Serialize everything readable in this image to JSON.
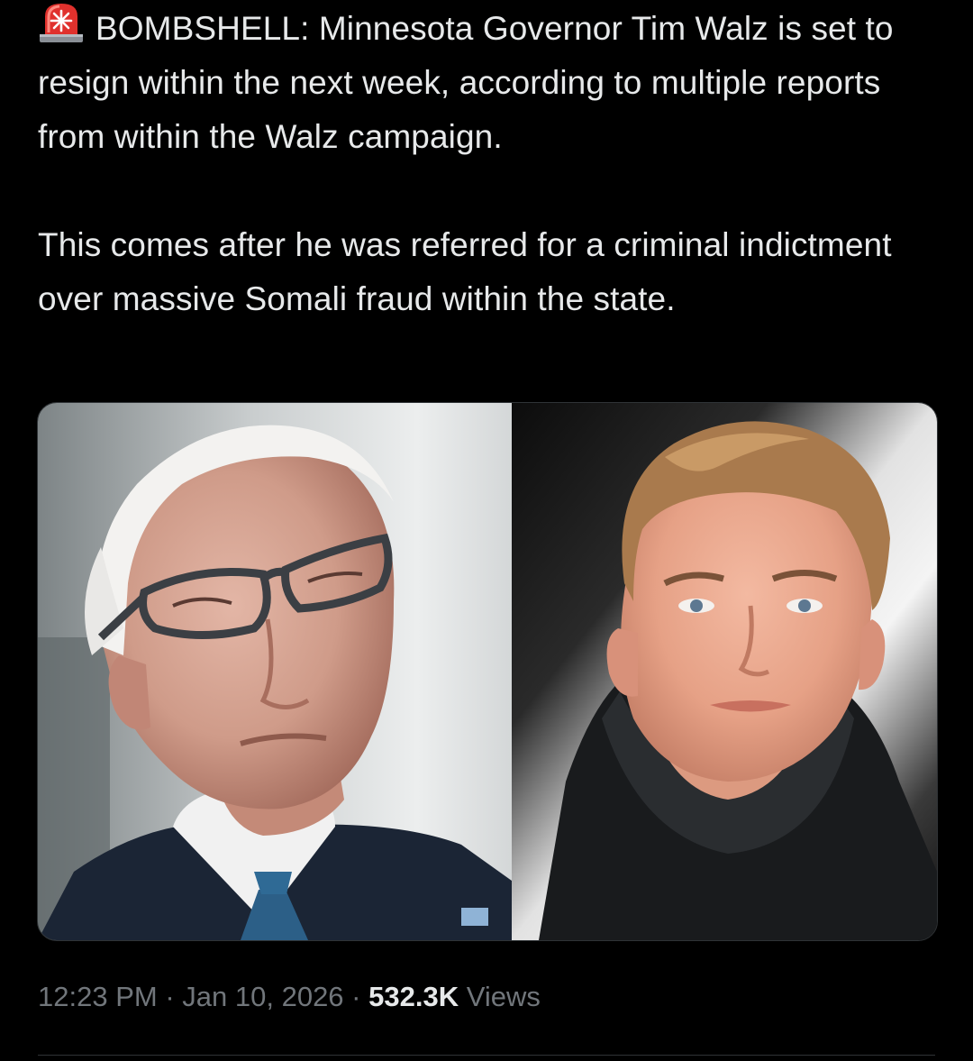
{
  "tweet": {
    "emoji_icon": "police-siren-icon",
    "line_first": "BOMBSHELL: Minnesota Governor Tim Walz is set to resign within the next week, according to multiple reports from within the Walz campaign.",
    "line_second": "This comes after he was referred for a criminal indictment over massive Somali fraud within the state."
  },
  "media": {
    "left_photo": "photo-older-man-glasses",
    "right_photo": "photo-young-man-hoodie"
  },
  "meta": {
    "time": "12:23 PM",
    "separator": "·",
    "date": "Jan 10, 2026",
    "views_count": "532.3K",
    "views_label": "Views"
  },
  "colors": {
    "background": "#000000",
    "text": "#e7e9ea",
    "secondary_text": "#71767b",
    "border": "#2f3336",
    "siren_red": "#e0312d"
  }
}
